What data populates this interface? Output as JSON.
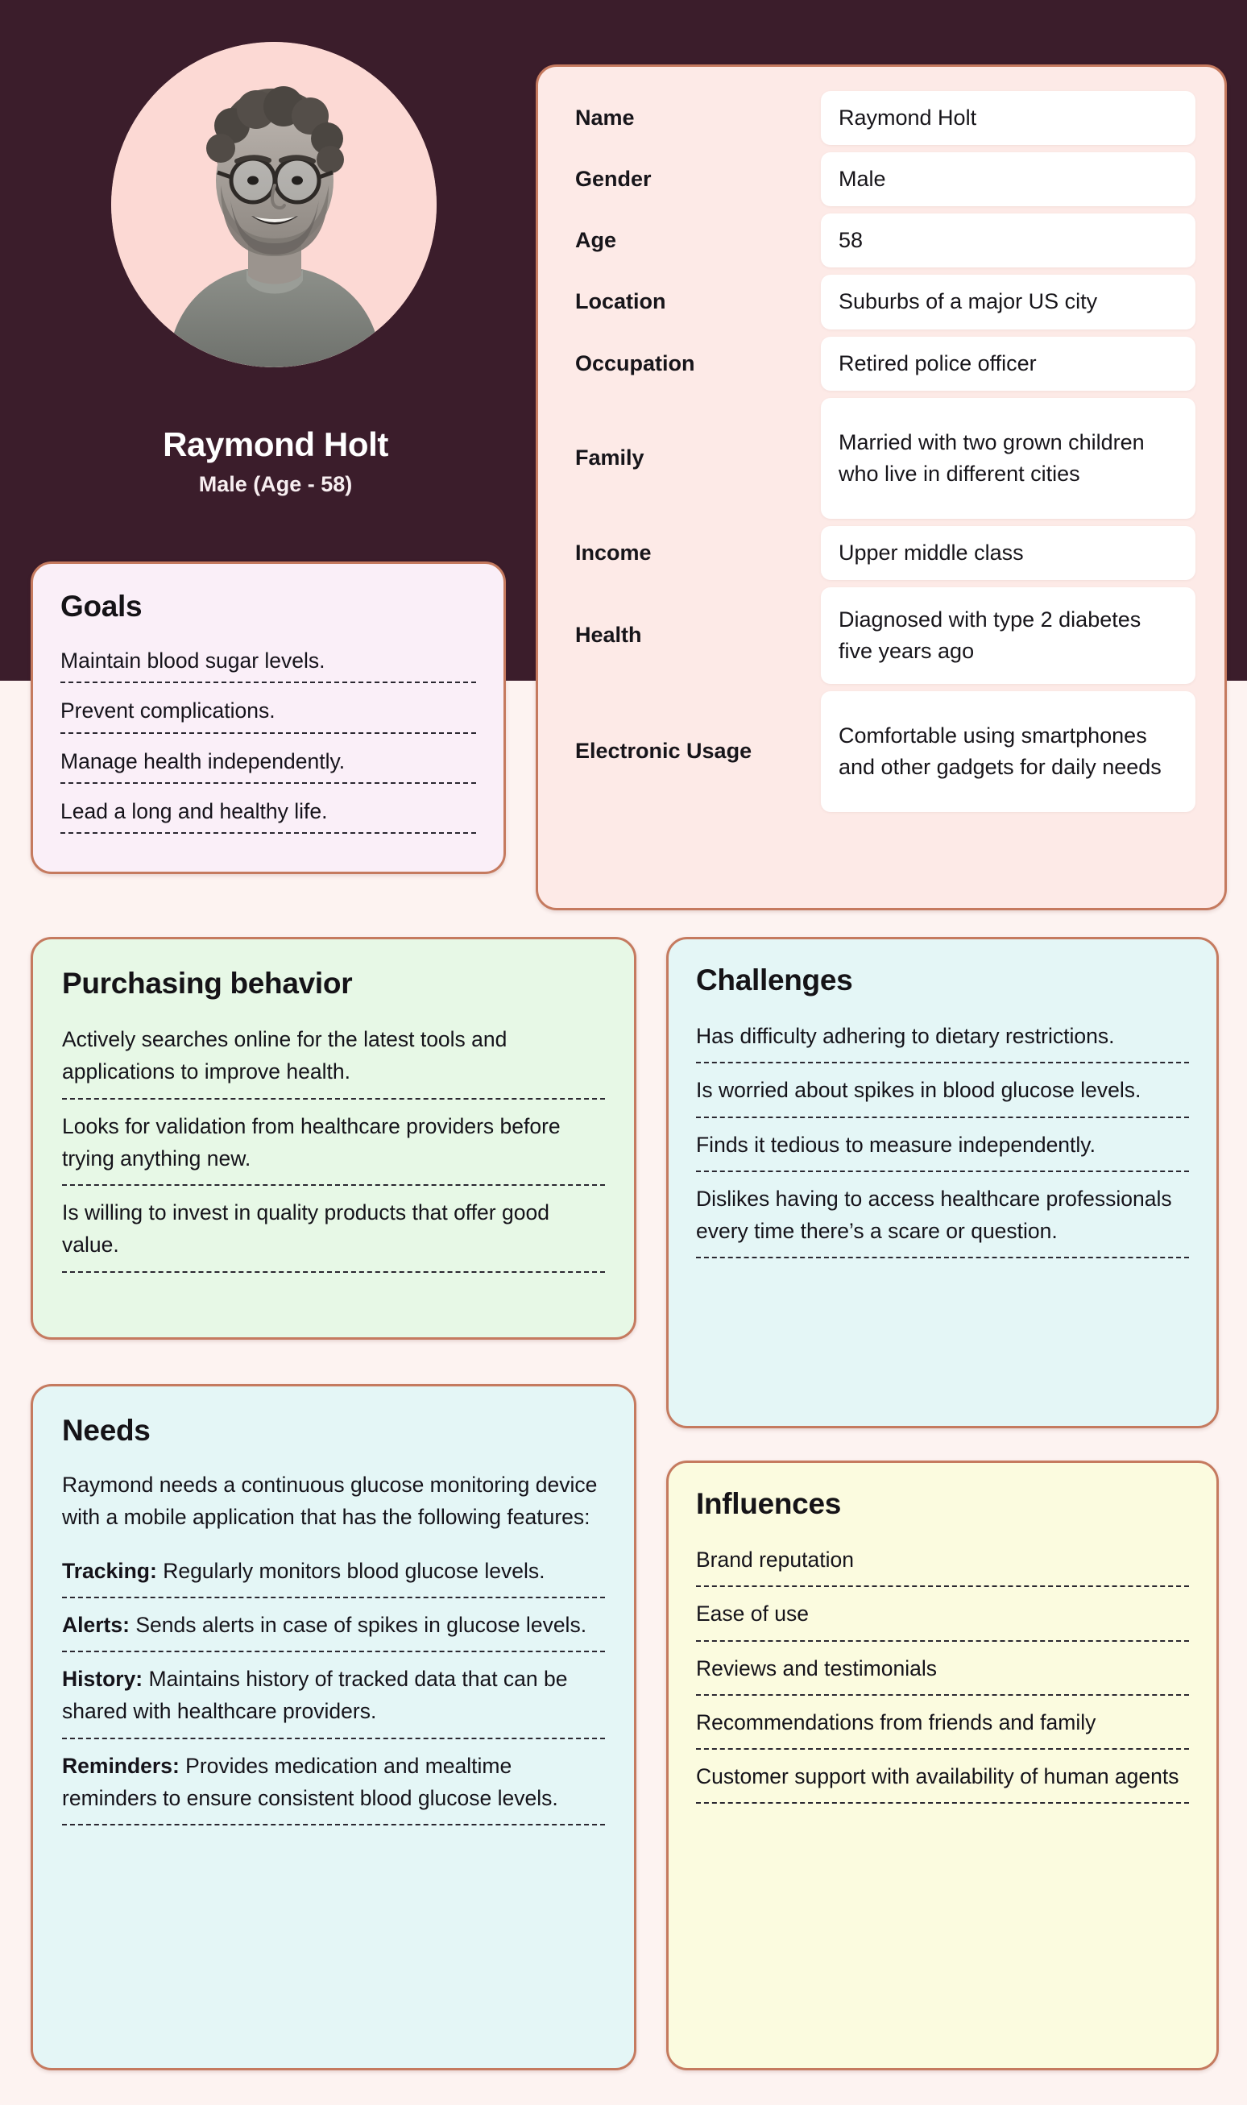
{
  "theme": {
    "hero_bg": "#3b1d2b",
    "page_bg": "#fdf3f1",
    "card_border": "#c57a5f",
    "info_card_bg": "#fdeae7",
    "goals_bg": "#faeff8",
    "purchasing_bg": "#e7f8e6",
    "needs_bg": "#e4f6f6",
    "challenges_bg": "#e4f6f6",
    "influences_bg": "#fbfbdf",
    "avatar_bg": "#fcd9d4"
  },
  "hero": {
    "avatar_alt": "portrait of a smiling bearded man with round glasses",
    "name": "Raymond Holt",
    "subtitle": "Male (Age - 58)"
  },
  "info": {
    "rows": [
      {
        "label": "Name",
        "value": "Raymond Holt"
      },
      {
        "label": "Gender",
        "value": "Male"
      },
      {
        "label": "Age",
        "value": "58"
      },
      {
        "label": "Location",
        "value": "Suburbs of a major US city"
      },
      {
        "label": "Occupation",
        "value": "Retired police officer"
      },
      {
        "label": "Family",
        "value": "Married with two grown children who live in different cities"
      },
      {
        "label": "Income",
        "value": "Upper middle class"
      },
      {
        "label": "Health",
        "value": "Diagnosed with type 2 diabetes five years ago"
      },
      {
        "label": "Electronic Usage",
        "value": "Comfortable using smartphones and other gadgets for daily needs"
      }
    ]
  },
  "goals": {
    "title": "Goals",
    "items": [
      "Maintain blood sugar levels.",
      "Prevent complications.",
      "Manage health independently.",
      "Lead a long and healthy life."
    ]
  },
  "purchasing": {
    "title": "Purchasing behavior",
    "items": [
      "Actively searches online for the latest tools and applications to improve health.",
      "Looks for validation from healthcare providers before trying anything new.",
      "Is willing to invest in quality products that offer good value."
    ]
  },
  "challenges": {
    "title": "Challenges",
    "items": [
      "Has difficulty adhering to dietary restrictions.",
      "Is worried about spikes in blood glucose levels.",
      "Finds it tedious to measure independently.",
      "Dislikes having to access healthcare professionals every time there’s a scare or question."
    ]
  },
  "needs": {
    "title": "Needs",
    "intro": "Raymond needs a continuous glucose monitoring device with a mobile application that has the following features:",
    "items": [
      {
        "label": "Tracking:",
        "text": " Regularly monitors blood glucose levels."
      },
      {
        "label": "Alerts:",
        "text": " Sends alerts in case of spikes in glucose levels."
      },
      {
        "label": "History:",
        "text": " Maintains history of tracked data that can be shared with healthcare providers."
      },
      {
        "label": "Reminders:",
        "text": " Provides medication and mealtime reminders to ensure consistent blood glucose levels."
      }
    ]
  },
  "influences": {
    "title": "Influences",
    "items": [
      "Brand reputation",
      "Ease of use",
      "Reviews and testimonials",
      "Recommendations from friends and family",
      "Customer support with availability of human agents"
    ]
  }
}
